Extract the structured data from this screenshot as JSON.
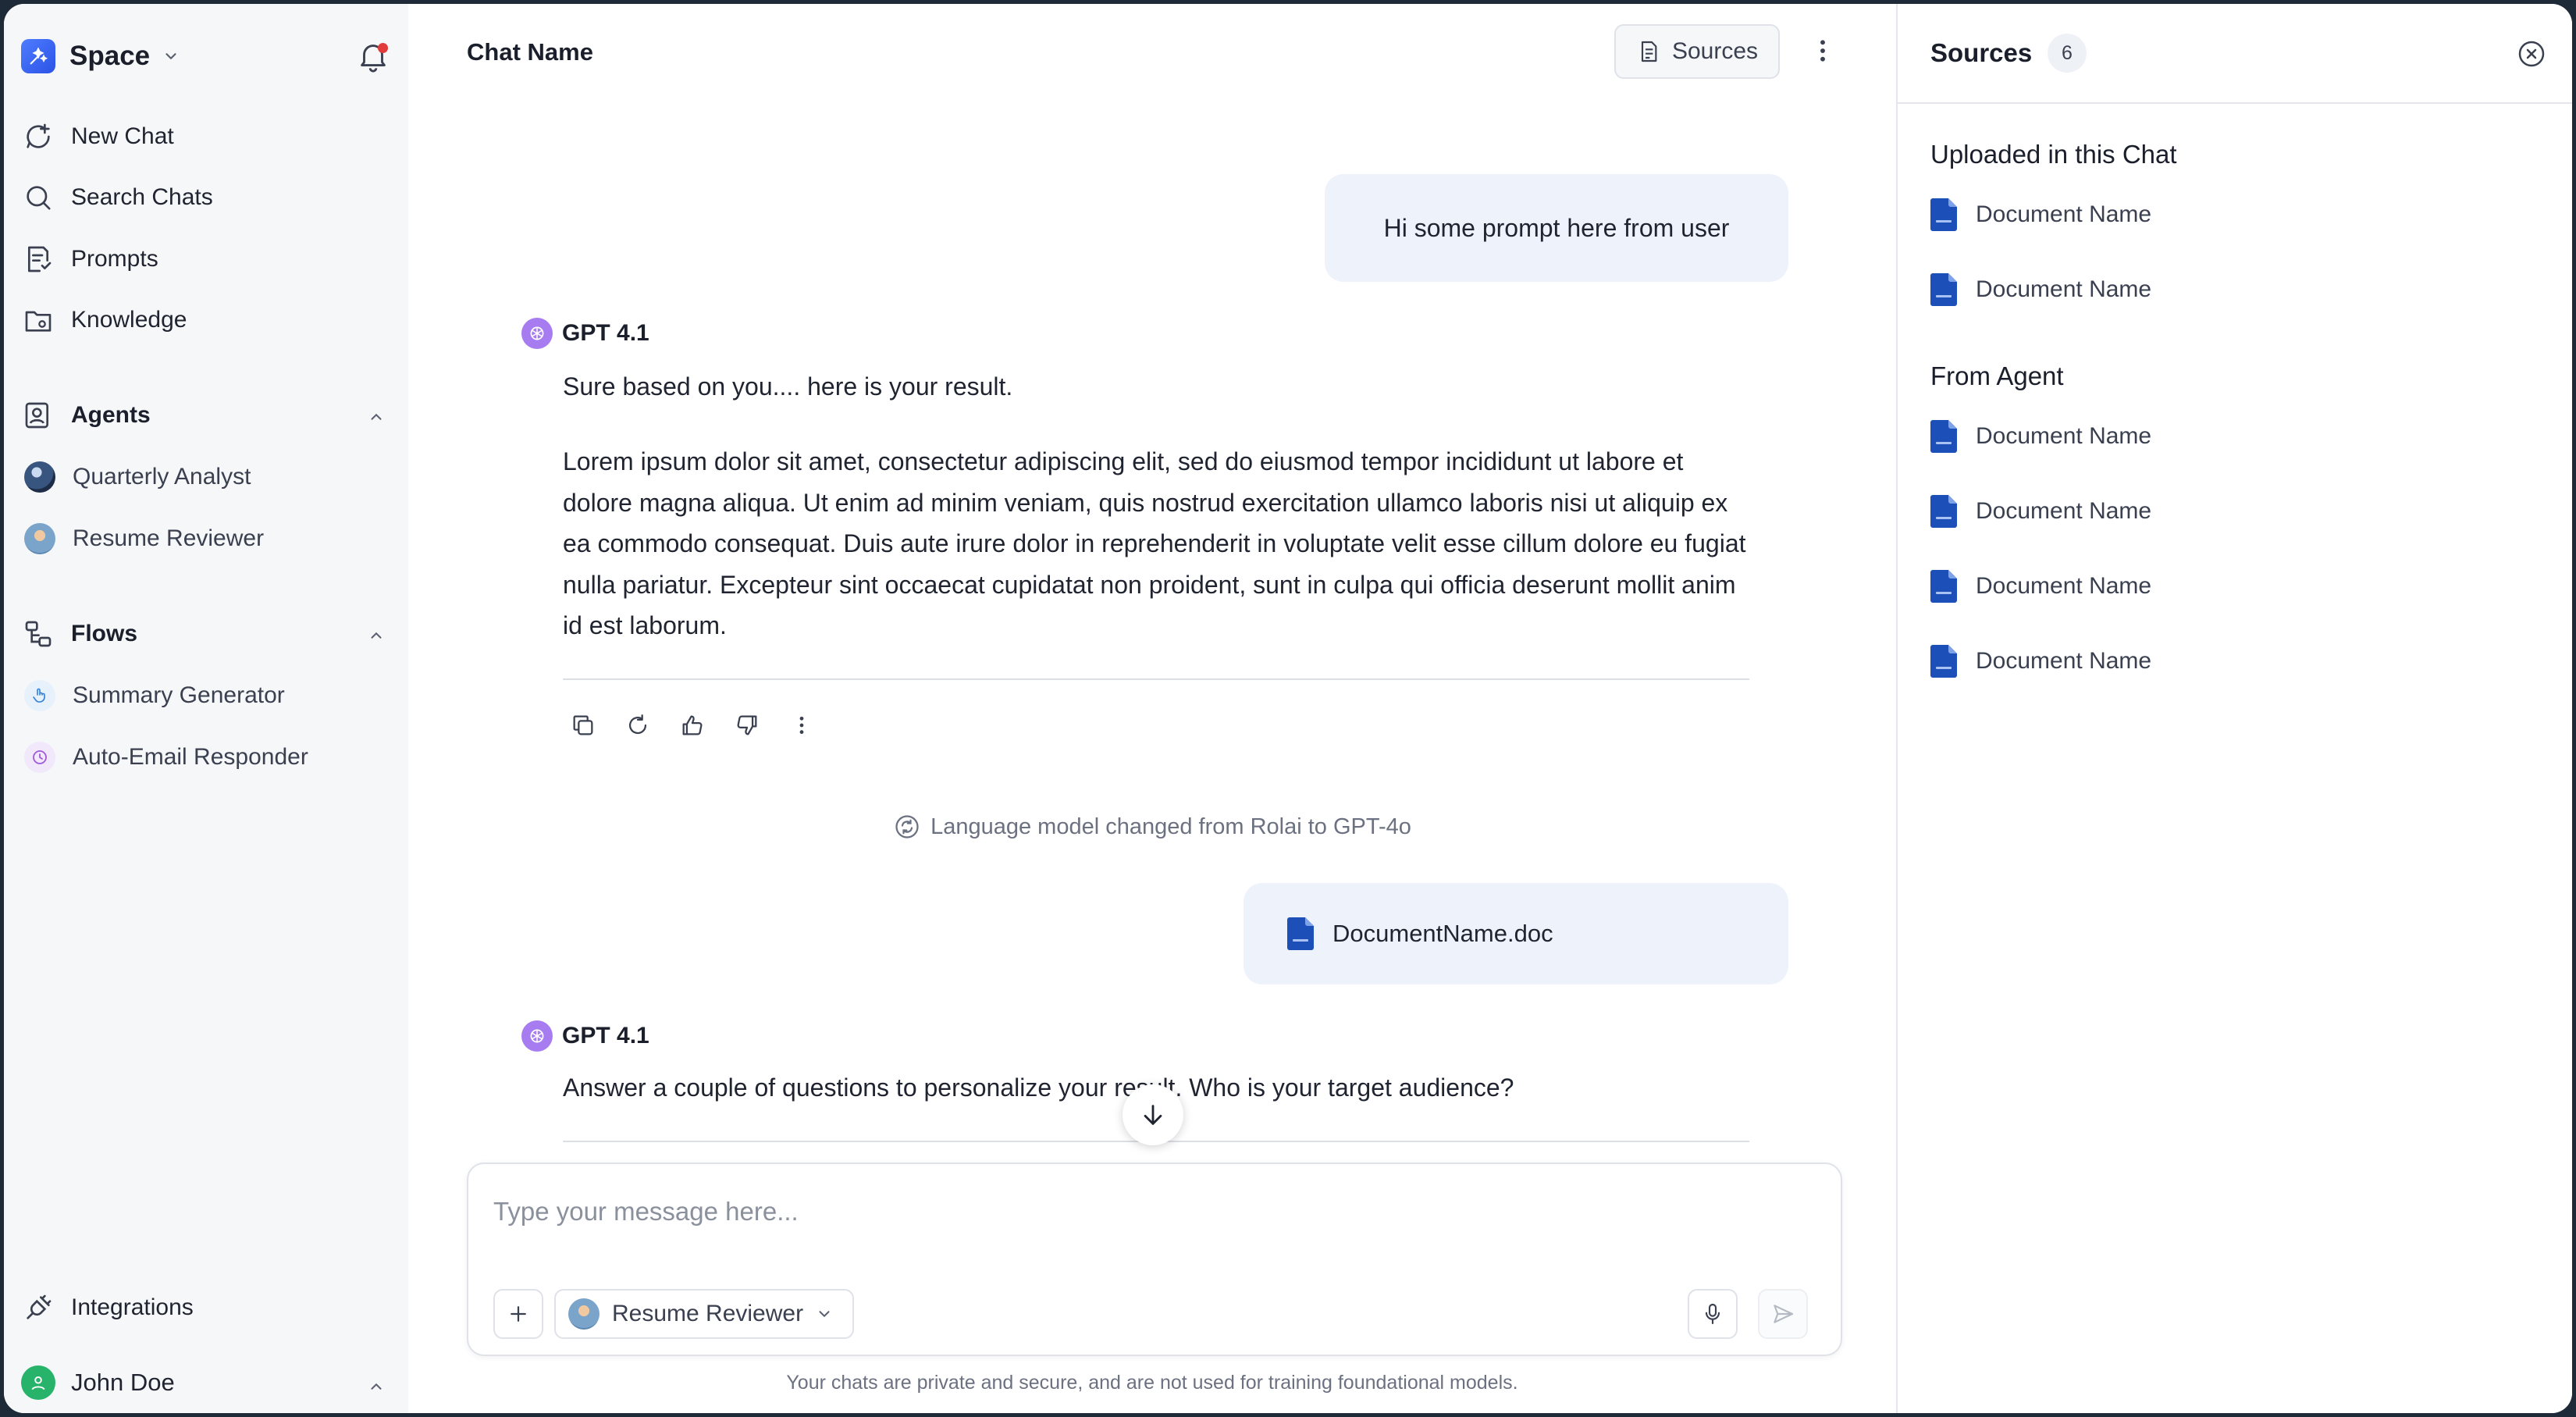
{
  "sidebar": {
    "space_name": "Space",
    "nav": [
      {
        "label": "New Chat",
        "icon": "new-chat-icon"
      },
      {
        "label": "Search Chats",
        "icon": "search-icon"
      },
      {
        "label": "Prompts",
        "icon": "prompts-icon"
      },
      {
        "label": "Knowledge",
        "icon": "knowledge-icon"
      }
    ],
    "agents_title": "Agents",
    "agents": [
      {
        "label": "Quarterly Analyst"
      },
      {
        "label": "Resume Reviewer"
      }
    ],
    "flows_title": "Flows",
    "flows": [
      {
        "label": "Summary Generator"
      },
      {
        "label": "Auto-Email Responder"
      }
    ],
    "integrations": "Integrations",
    "user_name": "John Doe"
  },
  "header": {
    "chat_name": "Chat Name",
    "sources_label": "Sources"
  },
  "messages": {
    "user_prompt": "Hi some prompt here from user",
    "bot1_name": "GPT 4.1",
    "bot1_intro": "Sure based on you.... here is your result.",
    "bot1_body": "Lorem ipsum dolor sit amet, consectetur adipiscing elit, sed do eiusmod tempor incididunt ut labore et dolore magna aliqua. Ut enim ad minim veniam, quis nostrud exercitation ullamco laboris nisi ut aliquip ex ea commodo consequat. Duis aute irure dolor in reprehenderit in voluptate velit esse cillum dolore eu fugiat nulla pariatur. Excepteur sint occaecat cupidatat non proident, sunt in culpa qui officia deserunt mollit anim id est laborum.",
    "system_note": "Language model changed from Rolai to GPT-4o",
    "file_name": "DocumentName.doc",
    "bot2_name": "GPT 4.1",
    "bot2_text": "Answer a couple of questions to personalize your result. Who is your target audience?"
  },
  "composer": {
    "placeholder": "Type your message here...",
    "agent_selected": "Resume Reviewer",
    "disclaimer": "Your chats are private and secure, and are not used for training foundational models."
  },
  "sources_panel": {
    "title": "Sources",
    "count": "6",
    "uploaded_title": "Uploaded in this Chat",
    "uploaded": [
      "Document Name",
      "Document Name"
    ],
    "agent_title": "From Agent",
    "from_agent": [
      "Document Name",
      "Document Name",
      "Document Name",
      "Document Name"
    ]
  },
  "colors": {
    "accent": "#2b53e6",
    "bubble": "#eef3fb",
    "doc_icon": "#1d4fb8",
    "gpt_badge": "#a77cf0",
    "notification": "#e23b3b",
    "user_avatar": "#27b36a"
  }
}
